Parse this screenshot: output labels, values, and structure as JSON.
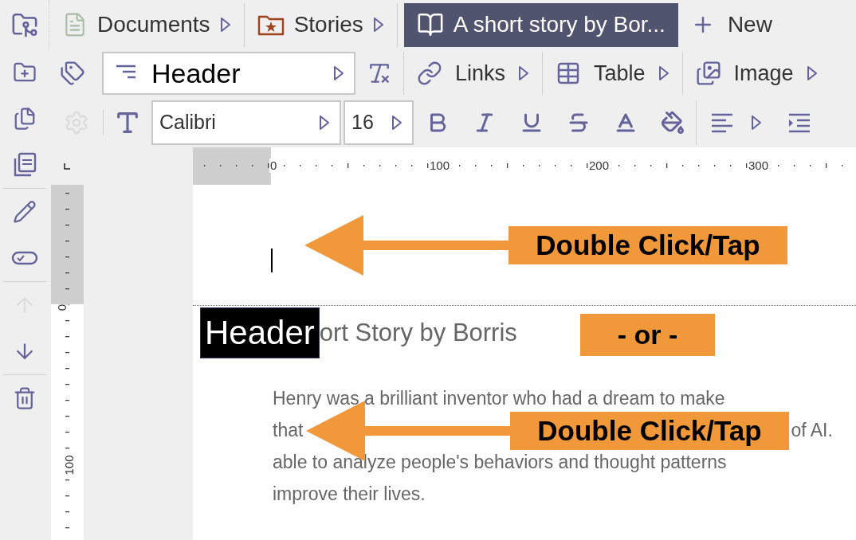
{
  "tabs": [
    {
      "kind": "documents",
      "label": "Documents",
      "selected": false
    },
    {
      "kind": "stories",
      "label": "Stories",
      "selected": false
    },
    {
      "kind": "story",
      "label": "A short story by Bor...",
      "selected": true
    }
  ],
  "new_button": {
    "label": "New"
  },
  "style_select": {
    "value": "Header"
  },
  "toolbar_buttons": [
    {
      "kind": "links",
      "label": "Links"
    },
    {
      "kind": "table",
      "label": "Table"
    },
    {
      "kind": "image",
      "label": "Image"
    }
  ],
  "font_select": {
    "value": "Calibri"
  },
  "size_select": {
    "value": "16"
  },
  "sidebar": {
    "items": [
      {
        "kind": "folder-plus",
        "disabled": false
      },
      {
        "kind": "copy",
        "disabled": false
      },
      {
        "kind": "pdf",
        "disabled": false
      },
      {
        "kind": "pencil",
        "disabled": false
      },
      {
        "kind": "pill",
        "disabled": false
      },
      {
        "kind": "up",
        "disabled": true
      },
      {
        "kind": "down",
        "disabled": false
      },
      {
        "kind": "trash",
        "disabled": false
      }
    ]
  },
  "settings_button": {
    "disabled": true
  },
  "ruler": {
    "h_labels": [
      "0",
      "100",
      "200",
      "300"
    ],
    "v_labels": [
      "0",
      "100"
    ]
  },
  "document": {
    "selected_text": "Header",
    "title_rest": "ort Story by Borris",
    "body_lines": [
      {
        "start": "Henry was a brilliant inventor who had a dream to make"
      },
      {
        "start": "that",
        "end": "of AI."
      },
      {
        "start": "able to analyze people's behaviors and thought patterns"
      },
      {
        "start": "improve their lives."
      }
    ]
  },
  "callouts": [
    {
      "kind": "arrow",
      "text": "Double Click/Tap"
    },
    {
      "kind": "plain",
      "text": "- or -"
    },
    {
      "kind": "arrow",
      "text": "Double Click/Tap"
    }
  ]
}
